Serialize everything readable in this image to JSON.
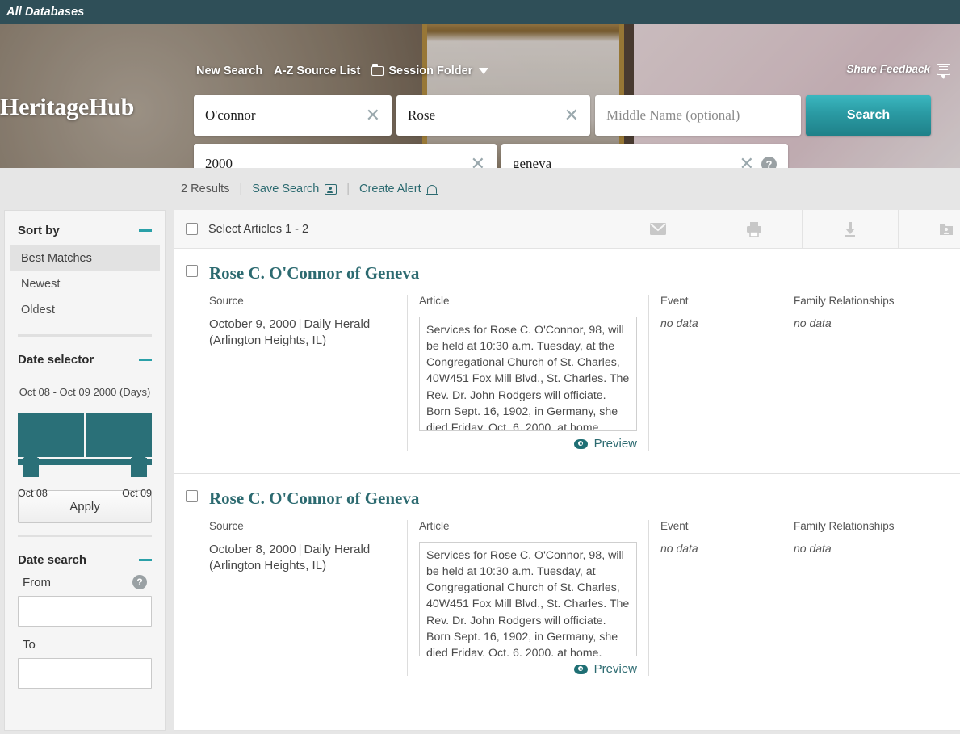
{
  "topbar": {
    "label": "All Databases"
  },
  "hero": {
    "brand": "HeritageHub",
    "nav": [
      {
        "label": "New Search",
        "icon": ""
      },
      {
        "label": "A-Z Source List",
        "icon": ""
      },
      {
        "label": "Session Folder",
        "icon": "folder-icon"
      }
    ],
    "feedback": "Share Feedback",
    "search": {
      "last_name": "O'connor",
      "first_name": "Rose",
      "middle_name_value": "",
      "middle_name_placeholder": "Middle Name (optional)",
      "year": "2000",
      "place": "geneva",
      "button": "Search"
    }
  },
  "meta": {
    "results_count": "2 Results",
    "save_search": "Save Search",
    "create_alert": "Create Alert",
    "separator": "|"
  },
  "sidebar": {
    "sort": {
      "title": "Sort by",
      "options": [
        "Best Matches",
        "Newest",
        "Oldest"
      ],
      "active": "Best Matches"
    },
    "date_selector": {
      "title": "Date selector",
      "range_label": "Oct 08 - Oct 09 2000 (Days)",
      "left_label": "Oct 08",
      "right_label": "Oct 09",
      "apply": "Apply",
      "bars": [
        100,
        100
      ]
    },
    "date_search": {
      "title": "Date search",
      "from_label": "From",
      "to_label": "To",
      "from_value": "",
      "to_value": "",
      "help": "?"
    }
  },
  "toolbar": {
    "select_label": "Select Articles 1 - 2",
    "actions": [
      "email-icon",
      "print-icon",
      "download-icon",
      "save-folder-icon"
    ]
  },
  "columns": {
    "source": "Source",
    "article": "Article",
    "event": "Event",
    "family": "Family Relationships"
  },
  "results": [
    {
      "title": "Rose C. O'Connor of Geneva",
      "date": "October 9, 2000",
      "publication": "Daily Herald (Arlington Heights, IL)",
      "article": "Services for Rose C. O'Connor, 98, will be held at 10:30 a.m. Tuesday, at the Congregational Church of St. Charles, 40W451 Fox Mill Blvd., St. Charles. The Rev. Dr. John Rodgers will officiate. Born Sept. 16, 1902, in Germany, she died Friday, Oct. 6, 2000, at home. Burial will be in Union Cemetery, M",
      "event": "no data",
      "family": "no data",
      "preview": "Preview"
    },
    {
      "title": "Rose C. O'Connor of Geneva",
      "date": "October 8, 2000",
      "publication": "Daily Herald (Arlington Heights, IL)",
      "article": "Services for Rose C. O'Connor, 98, will be held at 10:30 a.m. Tuesday, at Congregational Church of St. Charles, 40W451 Fox Mill Blvd., St. Charles. The Rev. Dr. John Rodgers will officiate. Born Sept. 16, 1902, in Germany, she died Friday, Oct. 6, 2000, at home. Burial will be in Union Cemetery, M",
      "event": "no data",
      "family": "no data",
      "preview": "Preview"
    }
  ],
  "colors": {
    "topbar": "#2f4f58",
    "teal": "#2a7078",
    "accent": "#2aa0a8",
    "link": "#2c6a70"
  }
}
